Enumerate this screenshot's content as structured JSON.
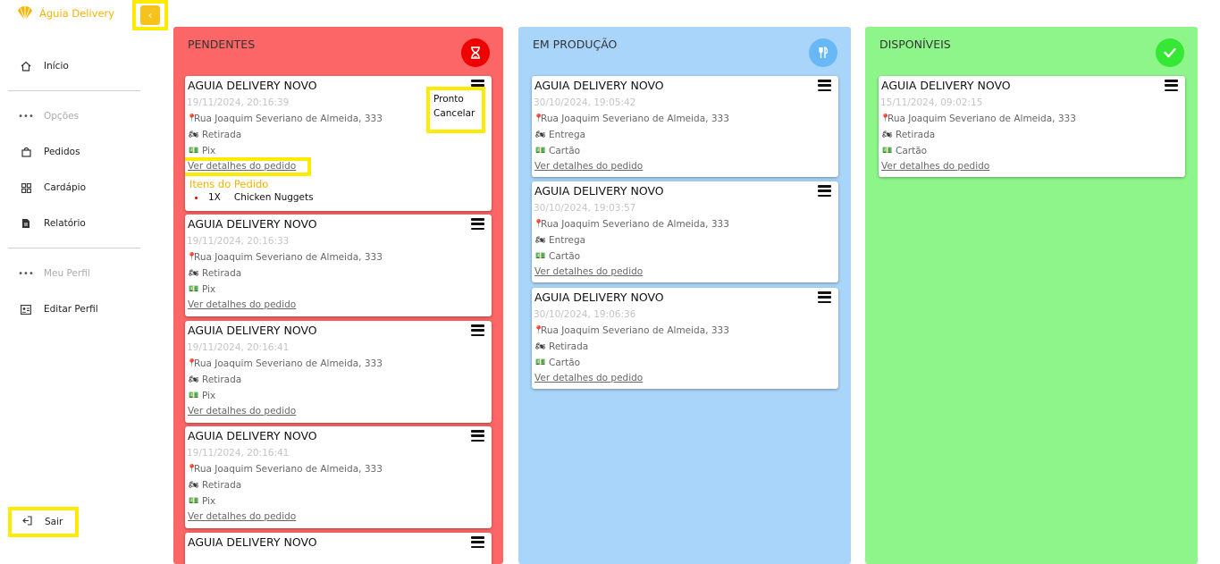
{
  "app": {
    "brand": "Águia Delivery",
    "collapse_icon": "chevron-left-icon",
    "accent": "#f7c21c"
  },
  "sidebar": {
    "items": [
      {
        "label": "Início",
        "icon": "home-icon",
        "muted": false
      },
      {
        "label": "Opções",
        "icon": "dots-icon",
        "muted": true
      },
      {
        "label": "Pedidos",
        "icon": "bag-icon",
        "muted": false
      },
      {
        "label": "Cardápio",
        "icon": "grid-icon",
        "muted": false
      },
      {
        "label": "Relatório",
        "icon": "document-icon",
        "muted": false
      },
      {
        "label": "Meu Perfil",
        "icon": "dots-icon",
        "muted": true
      },
      {
        "label": "Editar Perfil",
        "icon": "id-card-icon",
        "muted": false
      }
    ],
    "logout": "Sair"
  },
  "columns": {
    "pendentes": {
      "title": "PENDENTES",
      "color": "#fd6666",
      "icon": "hourglass-icon"
    },
    "producao": {
      "title": "EM PRODUÇÃO",
      "color": "#aad5fa",
      "icon": "utensils-icon"
    },
    "disponiveis": {
      "title": "DISPONÍVEIS",
      "color": "#8ef58b",
      "icon": "check-icon"
    }
  },
  "dropdown": {
    "option1": "Pronto",
    "option2": "Cancelar"
  },
  "expanded_items": {
    "title": "Itens do Pedido",
    "items": [
      {
        "qty": "1X",
        "name": "Chicken Nuggets"
      }
    ]
  },
  "pendentes_cards": [
    {
      "title": "AGUIA DELIVERY NOVO",
      "date": "19/11/2024, 20:16:39",
      "address": "Rua Joaquim Severiano de Almeida, 333",
      "delivery": "Retirada",
      "payment": "Pix",
      "link": "Ver detalhes do pedido"
    },
    {
      "title": "AGUIA DELIVERY NOVO",
      "date": "19/11/2024, 20:16:33",
      "address": "Rua Joaquim Severiano de Almeida, 333",
      "delivery": "Retirada",
      "payment": "Pix",
      "link": "Ver detalhes do pedido"
    },
    {
      "title": "AGUIA DELIVERY NOVO",
      "date": "19/11/2024, 20:16:41",
      "address": "Rua Joaquim Severiano de Almeida, 333",
      "delivery": "Retirada",
      "payment": "Pix",
      "link": "Ver detalhes do pedido"
    },
    {
      "title": "AGUIA DELIVERY NOVO",
      "date": "19/11/2024, 20:16:41",
      "address": "Rua Joaquim Severiano de Almeida, 333",
      "delivery": "Retirada",
      "payment": "Pix",
      "link": "Ver detalhes do pedido"
    },
    {
      "title": "AGUIA DELIVERY NOVO"
    }
  ],
  "producao_cards": [
    {
      "title": "AGUIA DELIVERY NOVO",
      "date": "30/10/2024, 19:05:42",
      "address": "Rua Joaquim Severiano de Almeida, 333",
      "delivery": "Entrega",
      "payment": "Cartão",
      "link": "Ver detalhes do pedido"
    },
    {
      "title": "AGUIA DELIVERY NOVO",
      "date": "30/10/2024, 19:03:57",
      "address": "Rua Joaquim Severiano de Almeida, 333",
      "delivery": "Entrega",
      "payment": "Cartão",
      "link": "Ver detalhes do pedido"
    },
    {
      "title": "AGUIA DELIVERY NOVO",
      "date": "30/10/2024, 19:06:36",
      "address": "Rua Joaquim Severiano de Almeida, 333",
      "delivery": "Retirada",
      "payment": "Cartão",
      "link": "Ver detalhes do pedido"
    }
  ],
  "disponiveis_cards": [
    {
      "title": "AGUIA DELIVERY NOVO",
      "date": "15/11/2024, 09:02:15",
      "address": "Rua Joaquim Severiano de Almeida, 333",
      "delivery": "Retirada",
      "payment": "Cartão",
      "link": "Ver detalhes do pedido"
    }
  ]
}
